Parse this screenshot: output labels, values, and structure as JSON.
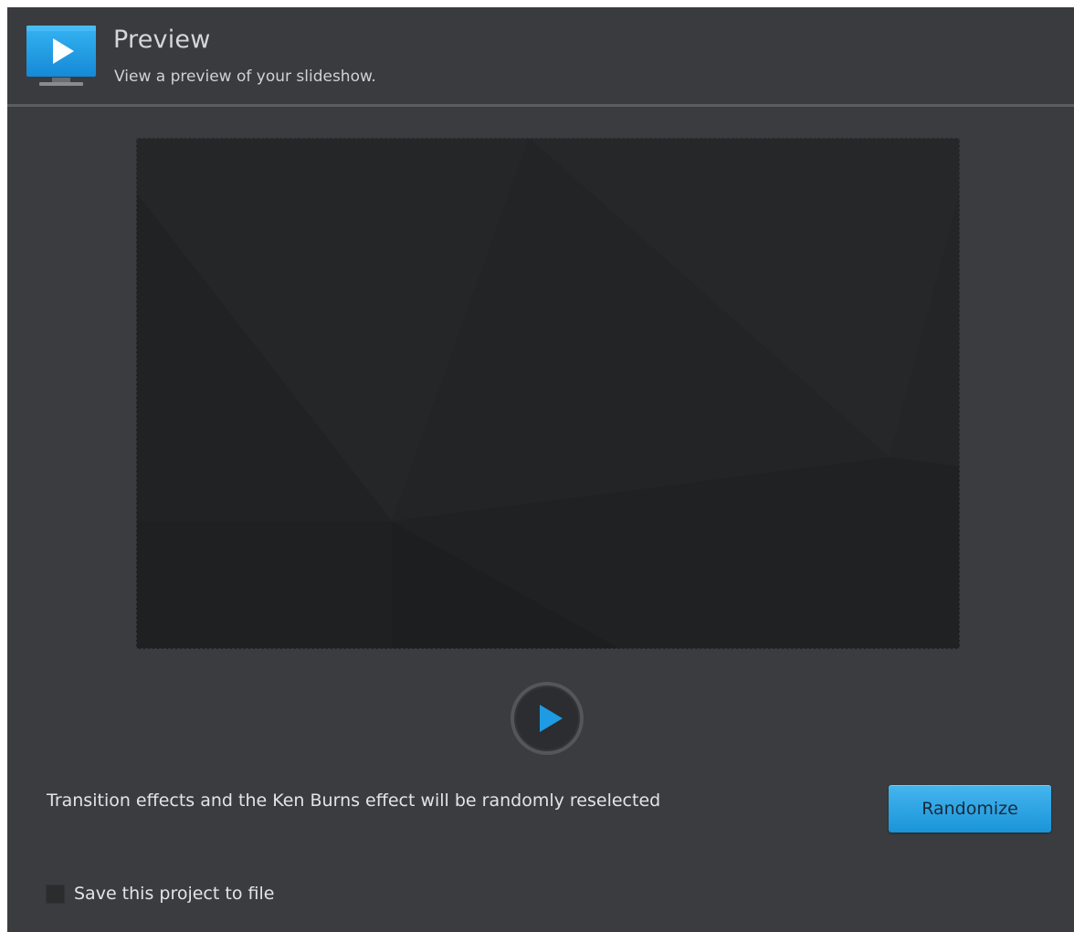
{
  "header": {
    "title": "Preview",
    "subtitle": "View a preview of your slideshow.",
    "icon": "monitor-play-icon"
  },
  "preview": {
    "play_icon": "play-icon",
    "accent_color": "#1e9be3"
  },
  "info": {
    "text": "Transition effects and the Ken Burns effect will be randomly reselected"
  },
  "actions": {
    "randomize_label": "Randomize"
  },
  "options": {
    "save_label": "Save this project to file",
    "save_checked": false
  }
}
